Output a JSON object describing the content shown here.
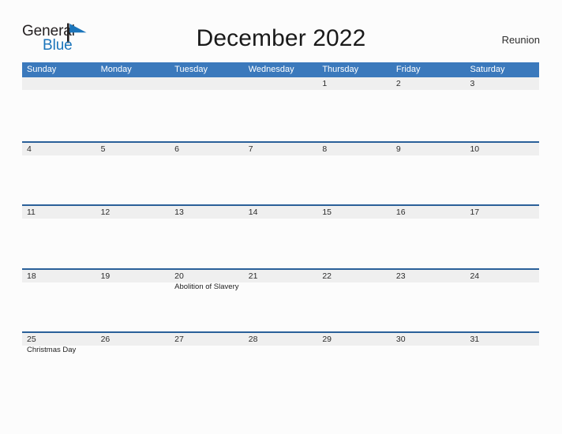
{
  "brand": {
    "name_part1": "General",
    "name_part2": "Blue",
    "mark": "triangle-flag-icon",
    "accent_color": "#1b75bb"
  },
  "header": {
    "title": "December 2022",
    "region": "Reunion"
  },
  "theme": {
    "header_band": "#3b79bc",
    "row_divider": "#2a6099",
    "date_band": "#efefef",
    "page_background": "#fcfcfc",
    "text": "#2b2b2b"
  },
  "calendar": {
    "month": "December",
    "year": "2022",
    "weekdays": [
      "Sunday",
      "Monday",
      "Tuesday",
      "Wednesday",
      "Thursday",
      "Friday",
      "Saturday"
    ],
    "weeks": [
      [
        {
          "date": "",
          "events": []
        },
        {
          "date": "",
          "events": []
        },
        {
          "date": "",
          "events": []
        },
        {
          "date": "",
          "events": []
        },
        {
          "date": "1",
          "events": []
        },
        {
          "date": "2",
          "events": []
        },
        {
          "date": "3",
          "events": []
        }
      ],
      [
        {
          "date": "4",
          "events": []
        },
        {
          "date": "5",
          "events": []
        },
        {
          "date": "6",
          "events": []
        },
        {
          "date": "7",
          "events": []
        },
        {
          "date": "8",
          "events": []
        },
        {
          "date": "9",
          "events": []
        },
        {
          "date": "10",
          "events": []
        }
      ],
      [
        {
          "date": "11",
          "events": []
        },
        {
          "date": "12",
          "events": []
        },
        {
          "date": "13",
          "events": []
        },
        {
          "date": "14",
          "events": []
        },
        {
          "date": "15",
          "events": []
        },
        {
          "date": "16",
          "events": []
        },
        {
          "date": "17",
          "events": []
        }
      ],
      [
        {
          "date": "18",
          "events": []
        },
        {
          "date": "19",
          "events": []
        },
        {
          "date": "20",
          "events": [
            "Abolition of Slavery"
          ]
        },
        {
          "date": "21",
          "events": []
        },
        {
          "date": "22",
          "events": []
        },
        {
          "date": "23",
          "events": []
        },
        {
          "date": "24",
          "events": []
        }
      ],
      [
        {
          "date": "25",
          "events": [
            "Christmas Day"
          ]
        },
        {
          "date": "26",
          "events": []
        },
        {
          "date": "27",
          "events": []
        },
        {
          "date": "28",
          "events": []
        },
        {
          "date": "29",
          "events": []
        },
        {
          "date": "30",
          "events": []
        },
        {
          "date": "31",
          "events": []
        }
      ]
    ]
  }
}
